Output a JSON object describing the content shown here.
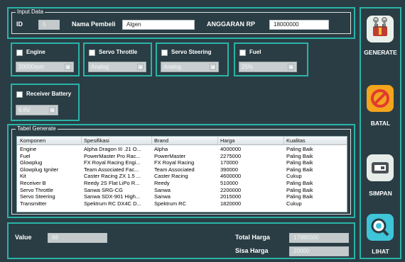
{
  "input_data": {
    "legend": "Input Data",
    "id_label": "ID",
    "id_value": "5",
    "nama_label": "Nama Pembeli",
    "nama_value": "Algen",
    "anggaran_label": "ANGGARAN RP",
    "anggaran_value": "18000000"
  },
  "options": {
    "engine": {
      "label": "Engine",
      "value": "30000rpm"
    },
    "servo_throttle": {
      "label": "Servo Throttle",
      "value": "Analog"
    },
    "servo_steering": {
      "label": "Servo Steering",
      "value": "Analog"
    },
    "fuel": {
      "label": "Fuel",
      "value": "25%"
    },
    "receiver_battery": {
      "label": "Receiver Battery",
      "value": "6.6V"
    }
  },
  "table": {
    "legend": "Tabel Generate",
    "columns": [
      "Komponen",
      "Spesifikasi",
      "Brand",
      "Harga",
      "Kualitas"
    ],
    "rows": [
      [
        "Engine",
        "Alpha Dragon III .21 O...",
        "Alpha",
        "4000000",
        "Paling Baik"
      ],
      [
        "Fuel",
        "PowerMaster Pro Rac...",
        "PowerMaster",
        "2275000",
        "Paling Baik"
      ],
      [
        "Glowplug",
        "FX Royal Racing Engi...",
        "FX Royal Racing",
        "170000",
        "Paling Baik"
      ],
      [
        "Glowplug Igniter",
        "Team Associated Fac...",
        "Team Associated",
        "390000",
        "Paling Baik"
      ],
      [
        "Kit",
        "Caster Racing ZX 1.5 ...",
        "Caster Racing",
        "4600000",
        "Cukup"
      ],
      [
        "Receiver B",
        "Reedy 2S Flat LiPo R...",
        "Reedy",
        "510000",
        "Paling Baik"
      ],
      [
        "Servo Throttle",
        "Sanwa SRG-CG",
        "Sanwa",
        "2200000",
        "Paling Baik"
      ],
      [
        "Servo Steering",
        "Sanwa SDX-901 High...",
        "Sanwa",
        "2015000",
        "Paling Baik"
      ],
      [
        "Transmitter",
        "Spektrum RC DX4C D...",
        "Spektrum RC",
        "1820000",
        "Cukup"
      ]
    ]
  },
  "summary": {
    "value_label": "Value",
    "value": "88",
    "total_label": "Total Harga",
    "total_value": "17980000",
    "sisa_label": "Sisa Harga",
    "sisa_value": "20000"
  },
  "sidebar": {
    "generate": {
      "label": "GENERATE",
      "icon": "tools-icon"
    },
    "batal": {
      "label": "BATAL",
      "icon": "cancel-icon"
    },
    "simpan": {
      "label": "SIMPAN",
      "icon": "save-icon"
    },
    "lihat": {
      "label": "LIHAT",
      "icon": "search-icon"
    }
  },
  "colors": {
    "background": "#2a3d44",
    "accent": "#2ab3a8",
    "generate_icon": "#e9f0ea",
    "batal_icon": "#f2a51d",
    "simpan_icon": "#e6ece7",
    "lihat_icon": "#3fc4d8"
  }
}
